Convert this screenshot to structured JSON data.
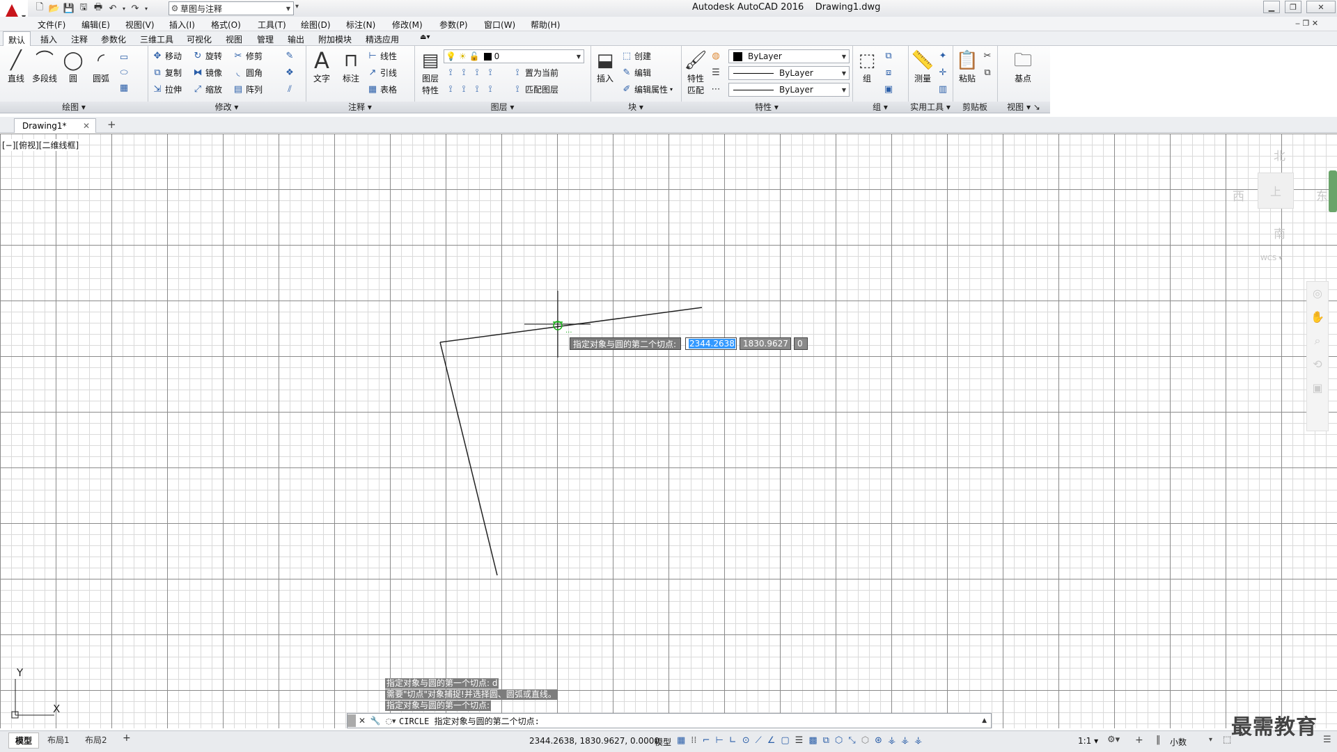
{
  "titlebar": {
    "workspace": "草图与注释",
    "app_name": "Autodesk AutoCAD 2016",
    "file_name": "Drawing1.dwg"
  },
  "menu": [
    "文件(F)",
    "编辑(E)",
    "视图(V)",
    "插入(I)",
    "格式(O)",
    "工具(T)",
    "绘图(D)",
    "标注(N)",
    "修改(M)",
    "参数(P)",
    "窗口(W)",
    "帮助(H)"
  ],
  "ribbon_tabs": [
    "默认",
    "插入",
    "注释",
    "参数化",
    "三维工具",
    "可视化",
    "视图",
    "管理",
    "输出",
    "附加模块",
    "精选应用"
  ],
  "panels": {
    "draw": {
      "title": "绘图",
      "line": "直线",
      "polyline": "多段线",
      "circle": "圆",
      "arc": "圆弧"
    },
    "modify": {
      "title": "修改",
      "move": "移动",
      "rotate": "旋转",
      "trim": "修剪",
      "copy": "复制",
      "mirror": "镜像",
      "fillet": "圆角",
      "stretch": "拉伸",
      "scale": "缩放",
      "array": "阵列"
    },
    "annotation": {
      "title": "注释",
      "text": "文字",
      "dimension": "标注",
      "linear": "线性",
      "leader": "引线",
      "table": "表格"
    },
    "layers": {
      "title": "图层",
      "properties_l1": "图层",
      "properties_l2": "特性",
      "layer_value": "0",
      "set_current": "置为当前",
      "match_layer": "匹配图层"
    },
    "block": {
      "title": "块",
      "insert": "插入",
      "create": "创建",
      "edit": "编辑",
      "edit_attr": "编辑属性"
    },
    "properties": {
      "title": "特性",
      "match_l1": "特性",
      "match_l2": "匹配",
      "color": "ByLayer",
      "linetype": "ByLayer",
      "lineweight": "ByLayer"
    },
    "groups": {
      "title": "组",
      "group": "组"
    },
    "utilities": {
      "title": "实用工具",
      "measure": "测量"
    },
    "clipboard": {
      "title": "剪贴板",
      "paste": "粘贴"
    },
    "view": {
      "title": "视图",
      "base": "基点"
    }
  },
  "doc_tab": "Drawing1*",
  "viewport_label": "[−][俯视][二维线框]",
  "viewcube": {
    "north": "北",
    "south": "南",
    "west": "西",
    "east": "东",
    "top": "上",
    "wcs": "WCS"
  },
  "dynamic_input": {
    "prompt": "指定对象与圆的第二个切点:",
    "x_value": "2344.2638",
    "y_value": "1830.9627",
    "z_value": "0"
  },
  "command_history": [
    "指定对象与圆的第一个切点:  d",
    "需要\"切点\"对象捕捉!并选择圆、圆弧或直线。",
    "指定对象与圆的第一个切点:"
  ],
  "command_line": "CIRCLE 指定对象与圆的第二个切点:",
  "ucs": {
    "x": "X",
    "y": "Y"
  },
  "layout_tabs": [
    "模型",
    "布局1",
    "布局2"
  ],
  "status": {
    "coords": "2344.2638, 1830.9627, 0.0000",
    "space": "模型",
    "scale": "1:1",
    "units": "小数"
  },
  "watermark": "最需教育"
}
